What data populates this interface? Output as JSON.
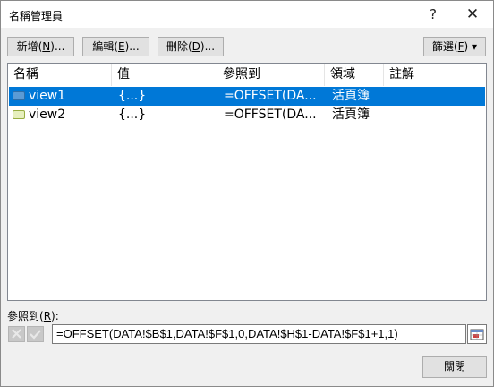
{
  "window": {
    "title": "名稱管理員",
    "help_glyph": "?",
    "close_glyph": "✕"
  },
  "toolbar": {
    "new": {
      "text": "新增(",
      "key": "N",
      "suffix": ")..."
    },
    "edit": {
      "text": "編輯(",
      "key": "E",
      "suffix": ")..."
    },
    "delete": {
      "text": "刪除(",
      "key": "D",
      "suffix": ")..."
    },
    "filter": {
      "text": "篩選(",
      "key": "F",
      "suffix": ")",
      "arrow": "▾"
    }
  },
  "list": {
    "columns": [
      "名稱",
      "值",
      "參照到",
      "領域",
      "註解"
    ],
    "rows": [
      {
        "name": "view1",
        "value": "{...}",
        "refers_to": "=OFFSET(DA...",
        "scope": "活頁簿",
        "comment": "",
        "icon": "name-range-icon",
        "selected": true
      },
      {
        "name": "view2",
        "value": "{...}",
        "refers_to": "=OFFSET(DA...",
        "scope": "活頁簿",
        "comment": "",
        "icon": "name-range-icon",
        "selected": false
      }
    ]
  },
  "refers_to": {
    "label_text": "參照到(",
    "label_key": "R",
    "label_suffix": "):",
    "value": "=OFFSET(DATA!$B$1,DATA!$F$1,0,DATA!$H$1-DATA!$F$1+1,1)"
  },
  "footer": {
    "close_label": "關閉"
  },
  "colors": {
    "selection": "#0078d7",
    "background": "#f0f0f0"
  }
}
